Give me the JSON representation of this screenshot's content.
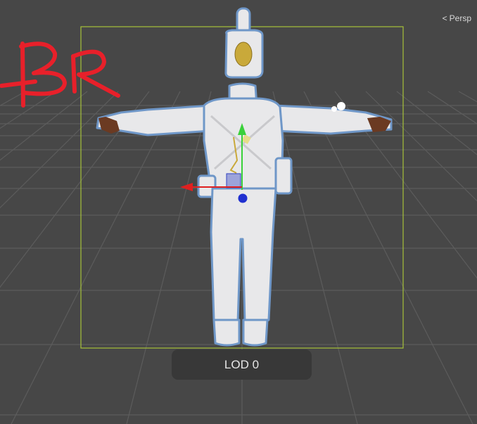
{
  "scene_view": {
    "camera_mode_label": "Persp",
    "lod_label": "LOD 0",
    "annotation_text": "BR",
    "colors": {
      "background": "#474747",
      "grid": "#5c5c5c",
      "bounds": "#a6c23a",
      "annotation": "#e8202a",
      "model": "#e8e8ea",
      "outline": "#6f97c8",
      "gizmo_y": "#3ad13a",
      "gizmo_x": "#e02020",
      "gizmo_z": "#2030d0"
    }
  }
}
